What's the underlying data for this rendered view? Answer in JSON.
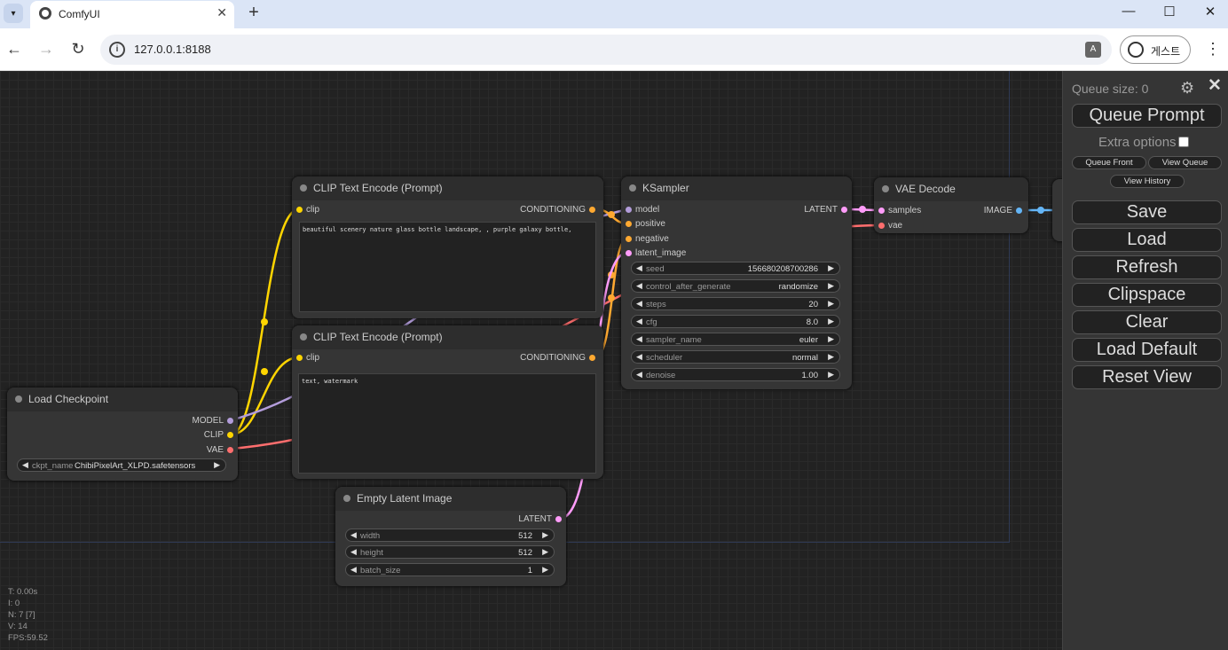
{
  "browser": {
    "tab_title": "ComfyUI",
    "url": "127.0.0.1:8188",
    "profile_label": "게스트",
    "icons": [
      "tab-search-icon",
      "favicon-icon",
      "close-icon",
      "new-tab-icon",
      "minimize-icon",
      "maximize-icon",
      "close-window-icon",
      "back-icon",
      "forward-icon",
      "reload-icon",
      "site-info-icon",
      "translate-icon",
      "profile-icon",
      "menu-icon"
    ]
  },
  "nodes": {
    "clip_pos": {
      "title": "CLIP Text Encode (Prompt)",
      "input_clip": "clip",
      "output": "CONDITIONING",
      "text": "beautiful scenery nature glass bottle landscape, , purple galaxy bottle,"
    },
    "clip_neg": {
      "title": "CLIP Text Encode (Prompt)",
      "input_clip": "clip",
      "output": "CONDITIONING",
      "text": "text, watermark"
    },
    "ksampler": {
      "title": "KSampler",
      "inputs": [
        "model",
        "positive",
        "negative",
        "latent_image"
      ],
      "output": "LATENT",
      "widgets": [
        {
          "name": "seed",
          "value": "156680208700286"
        },
        {
          "name": "control_after_generate",
          "value": "randomize"
        },
        {
          "name": "steps",
          "value": "20"
        },
        {
          "name": "cfg",
          "value": "8.0"
        },
        {
          "name": "sampler_name",
          "value": "euler"
        },
        {
          "name": "scheduler",
          "value": "normal"
        },
        {
          "name": "denoise",
          "value": "1.00"
        }
      ]
    },
    "vae_decode": {
      "title": "VAE Decode",
      "inputs": [
        "samples",
        "vae"
      ],
      "output": "IMAGE"
    },
    "load_checkpoint": {
      "title": "Load Checkpoint",
      "outputs": [
        "MODEL",
        "CLIP",
        "VAE"
      ],
      "widget_name": "ckpt_name",
      "widget_value": "ChibiPixelArt_XLPD.safetensors"
    },
    "empty_latent": {
      "title": "Empty Latent Image",
      "output": "LATENT",
      "widgets": [
        {
          "name": "width",
          "value": "512"
        },
        {
          "name": "height",
          "value": "512"
        },
        {
          "name": "batch_size",
          "value": "1"
        }
      ]
    }
  },
  "stats": [
    "T: 0.00s",
    "I: 0",
    "N: 7 [7]",
    "V: 14",
    "FPS:59.52"
  ],
  "menu": {
    "queue_size": "Queue size: 0",
    "queue_prompt": "Queue Prompt",
    "extra_options": "Extra options",
    "queue_front": "Queue Front",
    "view_queue": "View Queue",
    "view_history": "View History",
    "save": "Save",
    "load": "Load",
    "refresh": "Refresh",
    "clipspace": "Clipspace",
    "clear": "Clear",
    "load_default": "Load Default",
    "reset_view": "Reset View"
  },
  "colors": {
    "clip": "#ffd500",
    "conditioning": "#ffa931",
    "model": "#b39ddb",
    "latent": "#ff9cf9",
    "vae": "#ff6e6e",
    "image": "#64b5f6"
  }
}
